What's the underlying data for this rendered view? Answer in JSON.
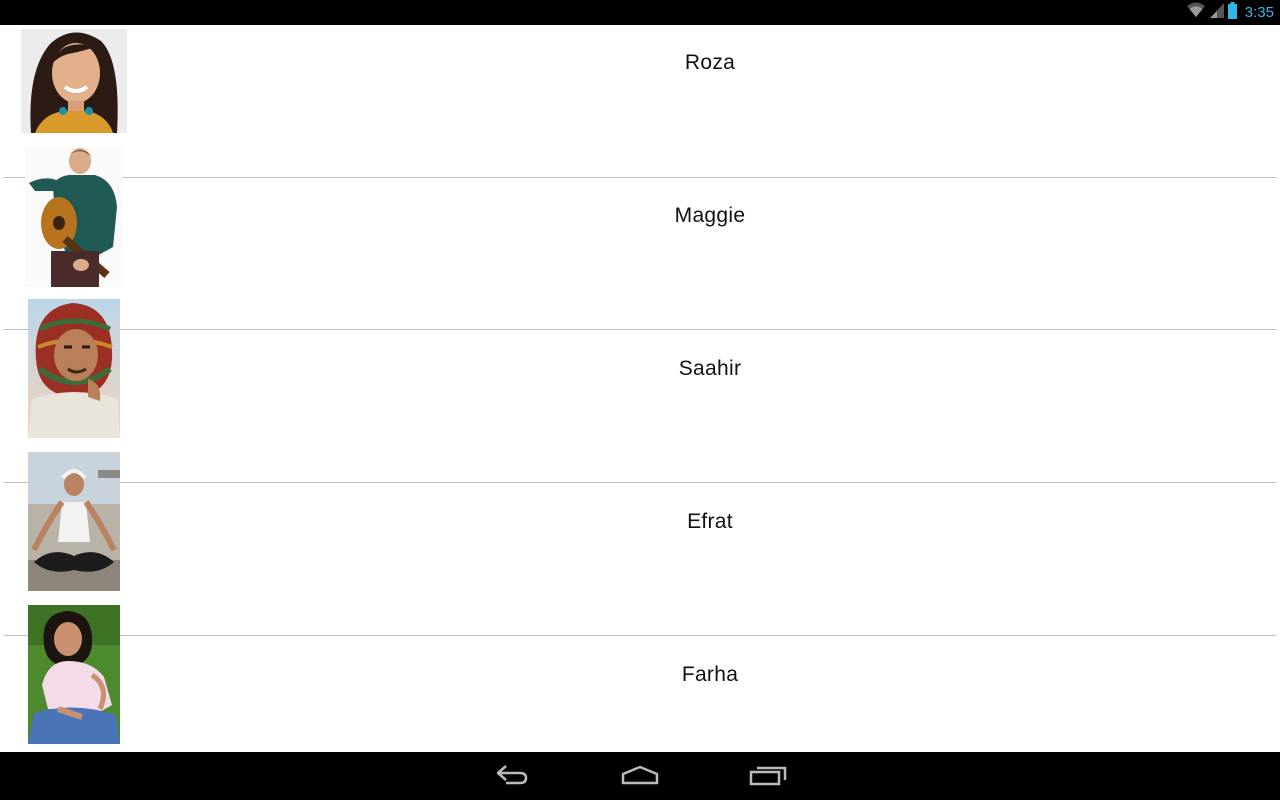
{
  "status_bar": {
    "time": "3:35",
    "icons": [
      "wifi-icon",
      "signal-icon",
      "battery-icon"
    ],
    "accent_color": "#33b5e5"
  },
  "list": {
    "items": [
      {
        "name": "Roza"
      },
      {
        "name": "Maggie"
      },
      {
        "name": "Saahir"
      },
      {
        "name": "Efrat"
      },
      {
        "name": "Farha"
      }
    ]
  },
  "nav_bar": {
    "buttons": [
      "back-icon",
      "home-icon",
      "recent-apps-icon"
    ]
  }
}
